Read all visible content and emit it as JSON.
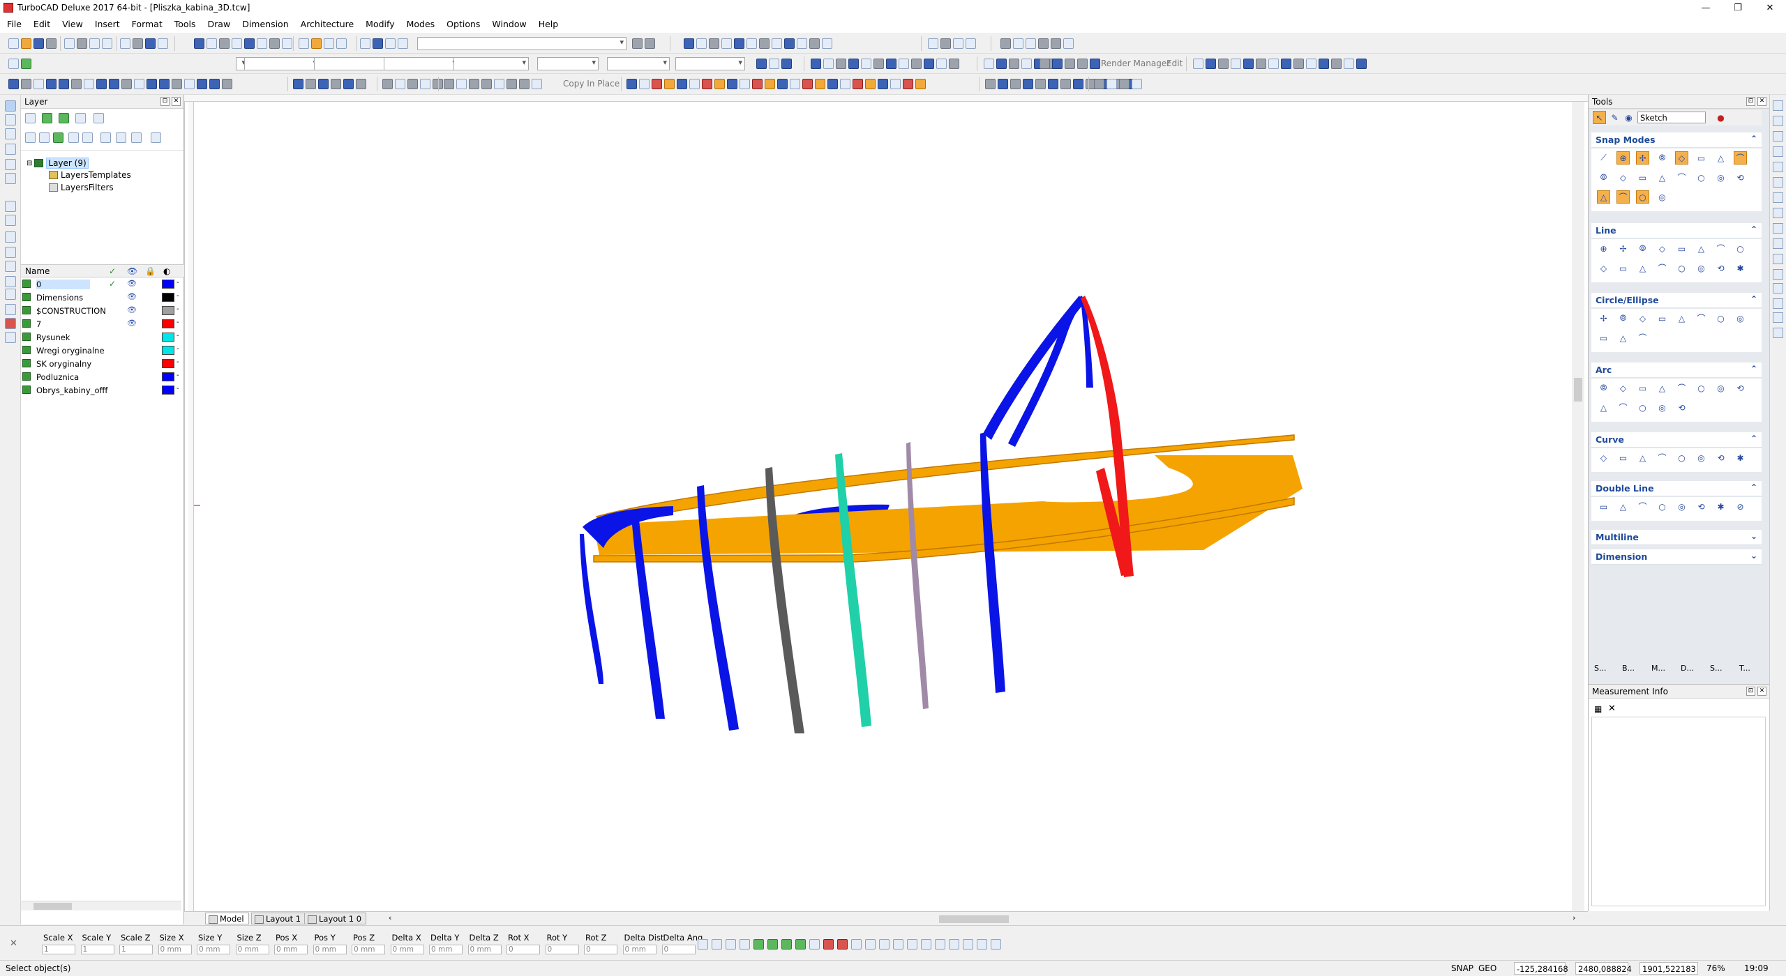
{
  "app": {
    "title": "TurboCAD Deluxe 2017 64-bit - [Pliszka_kabina_3D.tcw]",
    "window_buttons": [
      "—",
      "❐",
      "✕"
    ]
  },
  "menu": [
    "File",
    "Edit",
    "View",
    "Insert",
    "Format",
    "Tools",
    "Draw",
    "Dimension",
    "Architecture",
    "Modify",
    "Modes",
    "Options",
    "Window",
    "Help"
  ],
  "toolbar": {
    "render_manager_label": "Render Manager",
    "edit_label": "Edit",
    "copy_in_place_label": "Copy In Place"
  },
  "layer_panel": {
    "title": "Layer",
    "tree": [
      {
        "label": "Layer (9)",
        "selected": true
      },
      {
        "label": "LayersTemplates"
      },
      {
        "label": "LayersFilters"
      }
    ],
    "table_header": {
      "name": "Name"
    },
    "rows": [
      {
        "name": "0",
        "checked": true,
        "visible": true,
        "color": "#0000ff",
        "selected": true
      },
      {
        "name": "Dimensions",
        "checked": false,
        "visible": true,
        "color": "#000000"
      },
      {
        "name": "$CONSTRUCTION",
        "checked": false,
        "visible": true,
        "color": "#a0a0a0"
      },
      {
        "name": "7",
        "checked": false,
        "visible": true,
        "color": "#ff0000"
      },
      {
        "name": "Rysunek",
        "checked": false,
        "visible": false,
        "color": "#00e5e5"
      },
      {
        "name": "Wregi oryginalne",
        "checked": false,
        "visible": false,
        "color": "#00e5e5"
      },
      {
        "name": "SK oryginalny",
        "checked": false,
        "visible": false,
        "color": "#ff0000"
      },
      {
        "name": "Podluznica",
        "checked": false,
        "visible": false,
        "color": "#0000ff"
      },
      {
        "name": "Obrys_kabiny_offf",
        "checked": false,
        "visible": false,
        "color": "#0000ff"
      }
    ]
  },
  "tabs": [
    {
      "label": "Model",
      "active": true
    },
    {
      "label": "Layout 1",
      "active": false
    },
    {
      "label": "Layout 1 0",
      "active": false
    }
  ],
  "inspector": {
    "fields": [
      {
        "label": "Scale X",
        "value": "1"
      },
      {
        "label": "Scale Y",
        "value": "1"
      },
      {
        "label": "Scale Z",
        "value": "1"
      },
      {
        "label": "Size X",
        "value": "0 mm"
      },
      {
        "label": "Size Y",
        "value": "0 mm"
      },
      {
        "label": "Size Z",
        "value": "0 mm"
      },
      {
        "label": "Pos X",
        "value": "0 mm"
      },
      {
        "label": "Pos Y",
        "value": "0 mm"
      },
      {
        "label": "Pos Z",
        "value": "0 mm"
      },
      {
        "label": "Delta X",
        "value": "0 mm"
      },
      {
        "label": "Delta Y",
        "value": "0 mm"
      },
      {
        "label": "Delta Z",
        "value": "0 mm"
      },
      {
        "label": "Rot X",
        "value": "0"
      },
      {
        "label": "Rot Y",
        "value": "0"
      },
      {
        "label": "Rot Z",
        "value": "0"
      },
      {
        "label": "Delta Dist",
        "value": "0 mm"
      },
      {
        "label": "Delta Ang",
        "value": "0"
      }
    ]
  },
  "status": {
    "message": "Select object(s)",
    "snap": "SNAP",
    "geo": "GEO",
    "coord_x": "-125,284168",
    "coord_y": "2480,088824",
    "coord_z": "1901,522183",
    "zoom": "76%",
    "time": "19:09"
  },
  "tools_panel": {
    "title": "Tools",
    "mode_select": "Sketch",
    "sections": [
      {
        "name": "Snap Modes",
        "expanded": true
      },
      {
        "name": "Line",
        "expanded": true
      },
      {
        "name": "Circle/Ellipse",
        "expanded": true
      },
      {
        "name": "Arc",
        "expanded": true
      },
      {
        "name": "Curve",
        "expanded": true
      },
      {
        "name": "Double Line",
        "expanded": true
      },
      {
        "name": "Multiline",
        "expanded": false
      },
      {
        "name": "Dimension",
        "expanded": false
      }
    ],
    "bottom_tabs": [
      "S...",
      "B...",
      "M...",
      "D...",
      "S...",
      "T..."
    ]
  },
  "measurement_panel": {
    "title": "Measurement Info"
  },
  "colors": {
    "frame_blue": "#0a14e6",
    "frame_orange": "#f5a300",
    "frame_red": "#f01818",
    "frame_gray": "#5a5a5a",
    "frame_teal": "#20d0a8",
    "frame_mauve": "#a08aa8",
    "accent": "#1e4a9a"
  }
}
